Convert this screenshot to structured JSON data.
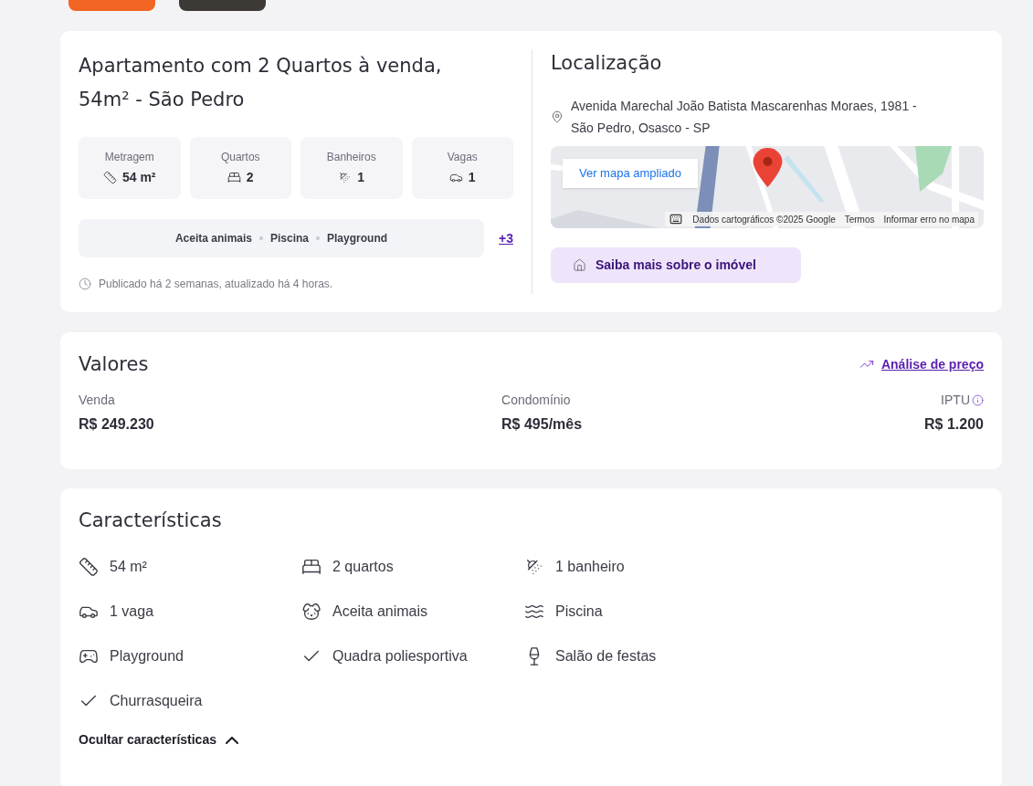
{
  "top_tabs": [
    {
      "color": "#f26522"
    },
    {
      "color": "#3d3a36"
    }
  ],
  "overview": {
    "title": "Apartamento com 2 Quartos à venda, 54m² - São Pedro",
    "stats": [
      {
        "kind": "area",
        "label": "Metragem",
        "value": "54 m²"
      },
      {
        "kind": "bedroom",
        "label": "Quartos",
        "value": "2"
      },
      {
        "kind": "bathroom",
        "label": "Banheiros",
        "value": "1"
      },
      {
        "kind": "parking",
        "label": "Vagas",
        "value": "1"
      }
    ],
    "amenities": [
      "Aceita animais",
      "Piscina",
      "Playground"
    ],
    "more_link": "+3",
    "published": "Publicado há 2 semanas, atualizado há 4 horas."
  },
  "location": {
    "title": "Localização",
    "address": "Avenida Marechal João Batista Mascarenhas Moraes, 1981 - São Pedro, Osasco - SP",
    "map": {
      "enlarge_button": "Ver mapa ampliado",
      "attribution": "Dados cartográficos ©2025 Google",
      "terms": "Termos",
      "report": "Informar erro no mapa"
    },
    "more_button": "Saiba mais sobre o imóvel"
  },
  "values": {
    "title": "Valores",
    "analysis_link": "Análise de preço",
    "items": [
      {
        "label": "Venda",
        "value": "R$ 249.230",
        "info": false
      },
      {
        "label": "Condomínio",
        "value": "R$ 495/mês",
        "info": false
      },
      {
        "label": "IPTU",
        "value": "R$ 1.200",
        "info": true
      }
    ]
  },
  "features": {
    "title": "Características",
    "items": [
      {
        "kind": "area",
        "label": "54 m²"
      },
      {
        "kind": "bedroom",
        "label": "2 quartos"
      },
      {
        "kind": "bathroom",
        "label": "1 banheiro"
      },
      {
        "kind": "parking",
        "label": "1 vaga"
      },
      {
        "kind": "pets",
        "label": "Aceita animais"
      },
      {
        "kind": "pool",
        "label": "Piscina"
      },
      {
        "kind": "playground",
        "label": "Playground"
      },
      {
        "kind": "amenity",
        "label": "Quadra poliesportiva"
      },
      {
        "kind": "party",
        "label": "Salão de festas"
      },
      {
        "kind": "amenity",
        "label": "Churrasqueira"
      }
    ],
    "toggle": {
      "label": "Ocultar características",
      "expanded": true
    }
  }
}
